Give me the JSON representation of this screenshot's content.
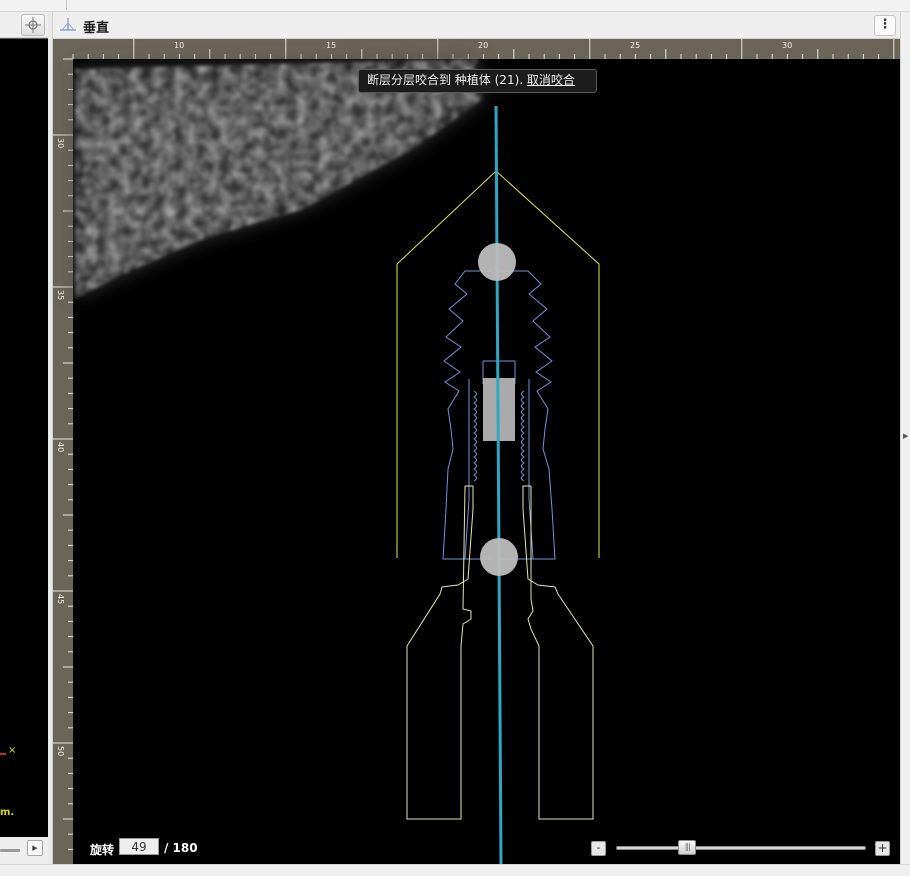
{
  "view": {
    "title": "垂直",
    "menu_icon": "⋮"
  },
  "ruler": {
    "x_labels": [
      "10",
      "15",
      "20",
      "25",
      "30"
    ],
    "y_labels": [
      "30",
      "35",
      "40",
      "45",
      "50"
    ]
  },
  "banner": {
    "message": "断层分层咬合到 种植体 (21). ",
    "cancel_label": "取消咬合"
  },
  "rotation": {
    "label": "旋转",
    "value": "49",
    "total": "/ 180"
  },
  "zoom": {
    "minus_label": "-",
    "plus_label": "+",
    "thumb_glyph": "|||",
    "level_fraction": 0.285
  },
  "left_panel": {
    "x_marker": "×",
    "m_marker": "m.",
    "next_glyph": "▶"
  },
  "colors": {
    "axis_line": "#2fa7c4",
    "safety_zone": "#e8e83a",
    "implant_outline": "#6f93e0",
    "abutment_outline": "#e6e6a8",
    "ruler_bg": "#6b6558",
    "marker_fill": "#bdbdbd"
  }
}
